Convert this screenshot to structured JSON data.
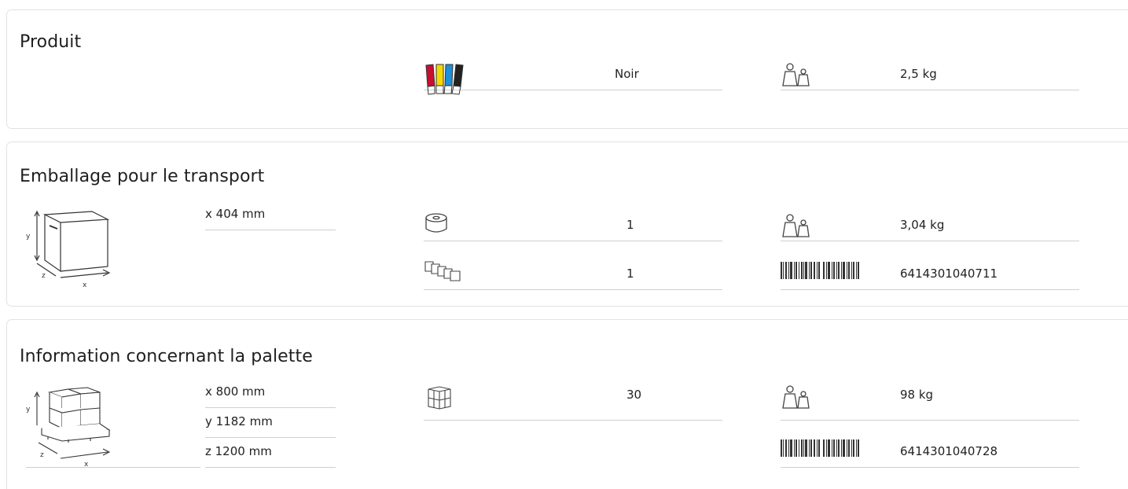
{
  "produit": {
    "title": "Produit",
    "color_value": "Noir",
    "weight_value": "2,5 kg"
  },
  "transport": {
    "title": "Emballage pour le transport",
    "dims": [
      "x 404 mm"
    ],
    "roll_count": "1",
    "pack_count": "1",
    "weight_value": "3,04 kg",
    "ean": "6414301040711"
  },
  "palette": {
    "title": "Information concernant la palette",
    "dims": [
      "x 800 mm",
      "y 1182 mm",
      "z 1200 mm"
    ],
    "box_count": "30",
    "weight_value": "98 kg",
    "ean": "6414301040728"
  },
  "icons": {
    "colors": "color-swatches-icon",
    "weight": "weights-icon",
    "roll": "roll-icon",
    "packs": "packs-icon",
    "barcode": "barcode-icon",
    "box": "carton-box-icon",
    "pallet": "pallet-icon",
    "cube": "cube-stack-icon"
  },
  "swatch_colors": [
    "#c8102e",
    "#f5d800",
    "#1e8fd8",
    "#222222"
  ]
}
